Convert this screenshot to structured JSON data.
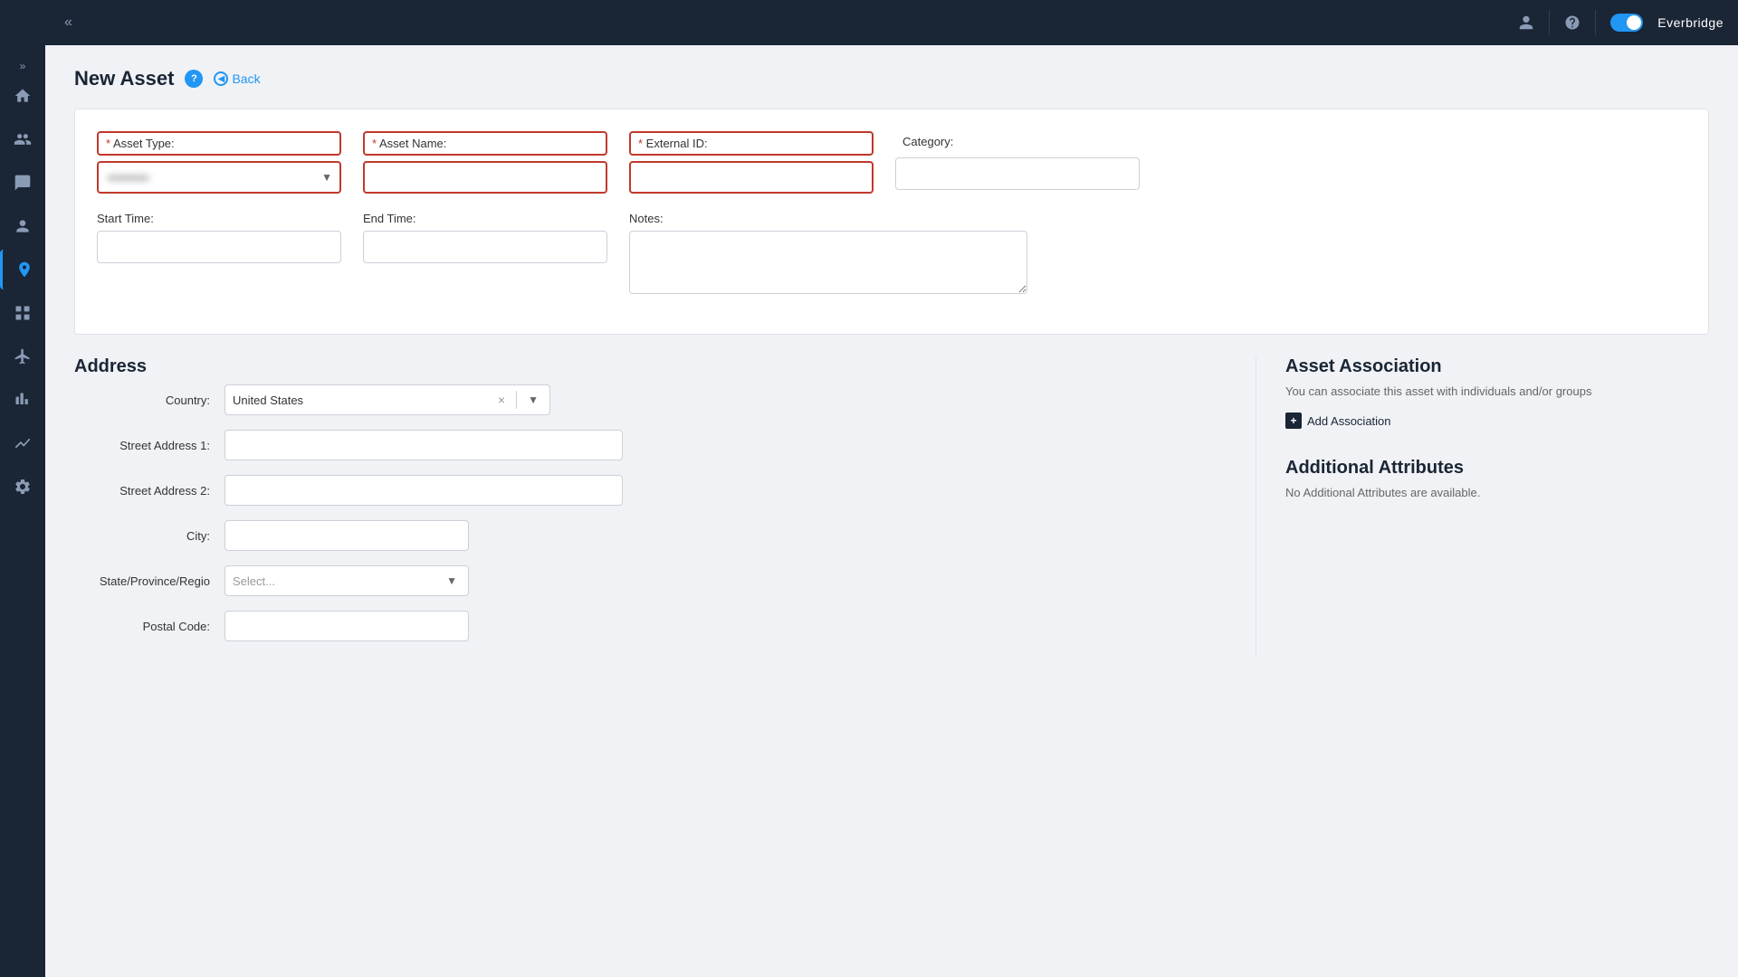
{
  "topbar": {
    "brand": "Everbridge",
    "chevron_label": "«",
    "expand_label": "»"
  },
  "sidebar": {
    "items": [
      {
        "id": "home",
        "icon": "⌂",
        "active": false
      },
      {
        "id": "people",
        "icon": "👥",
        "active": false
      },
      {
        "id": "alert",
        "icon": "📢",
        "active": false
      },
      {
        "id": "contacts",
        "icon": "👤",
        "active": false
      },
      {
        "id": "location",
        "icon": "📍",
        "active": true
      },
      {
        "id": "reports",
        "icon": "📊",
        "active": false
      },
      {
        "id": "flow",
        "icon": "✈",
        "active": false
      },
      {
        "id": "analytics",
        "icon": "⚡",
        "active": false
      },
      {
        "id": "chart",
        "icon": "📈",
        "active": false
      },
      {
        "id": "settings",
        "icon": "⚙",
        "active": false
      }
    ]
  },
  "page": {
    "title": "New Asset",
    "back_label": "Back"
  },
  "form": {
    "asset_type_label": "Asset Type:",
    "asset_type_placeholder": "",
    "asset_type_blurred": "••••••••••",
    "asset_name_label": "Asset Name:",
    "external_id_label": "External ID:",
    "category_label": "Category:",
    "start_time_label": "Start Time:",
    "end_time_label": "End Time:",
    "notes_label": "Notes:"
  },
  "address": {
    "section_title": "Address",
    "country_label": "Country:",
    "country_value": "United States",
    "street1_label": "Street Address 1:",
    "street2_label": "Street Address 2:",
    "city_label": "City:",
    "state_label": "State/Province/Regio",
    "state_placeholder": "Select...",
    "postal_label": "Postal Code:"
  },
  "asset_association": {
    "title": "Asset Association",
    "subtitle": "You can associate this asset with individuals and/or groups",
    "add_label": "Add Association"
  },
  "additional_attributes": {
    "title": "Additional Attributes",
    "empty_message": "No Additional Attributes are available."
  }
}
